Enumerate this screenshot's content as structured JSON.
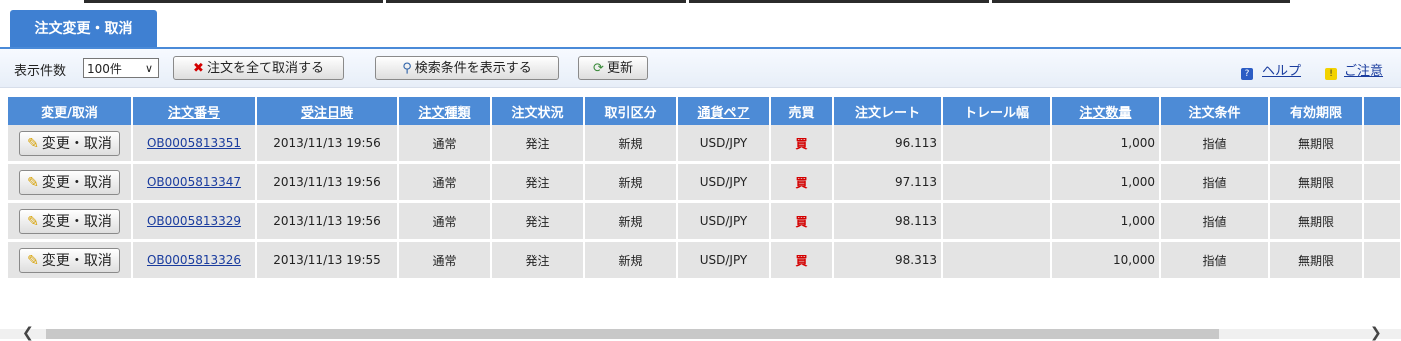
{
  "tab": {
    "label": "注文変更・取消"
  },
  "toolbar": {
    "count_label": "表示件数",
    "count_value": "100件",
    "cancel_all": "注文を全て取消する",
    "show_search": "検索条件を表示する",
    "refresh": "更新",
    "help": "ヘルプ",
    "caution": "ご注意"
  },
  "table": {
    "headers": [
      "変更/取消",
      "注文番号",
      "受注日時",
      "注文種類",
      "注文状況",
      "取引区分",
      "通貨ペア",
      "売買",
      "注文レート",
      "トレール幅",
      "注文数量",
      "注文条件",
      "有効期限"
    ],
    "edit_label": "変更・取消",
    "rows": [
      {
        "order_no": "OB0005813351",
        "date": "2013/11/13 19:56",
        "type": "通常",
        "status": "発注",
        "kind": "新規",
        "pair": "USD/JPY",
        "side": "買",
        "rate": "96.113",
        "trail": "",
        "qty": "1,000",
        "cond": "指値",
        "expiry": "無期限"
      },
      {
        "order_no": "OB0005813347",
        "date": "2013/11/13 19:56",
        "type": "通常",
        "status": "発注",
        "kind": "新規",
        "pair": "USD/JPY",
        "side": "買",
        "rate": "97.113",
        "trail": "",
        "qty": "1,000",
        "cond": "指値",
        "expiry": "無期限"
      },
      {
        "order_no": "OB0005813329",
        "date": "2013/11/13 19:56",
        "type": "通常",
        "status": "発注",
        "kind": "新規",
        "pair": "USD/JPY",
        "side": "買",
        "rate": "98.113",
        "trail": "",
        "qty": "1,000",
        "cond": "指値",
        "expiry": "無期限"
      },
      {
        "order_no": "OB0005813326",
        "date": "2013/11/13 19:55",
        "type": "通常",
        "status": "発注",
        "kind": "新規",
        "pair": "USD/JPY",
        "side": "買",
        "rate": "98.313",
        "trail": "",
        "qty": "10,000",
        "cond": "指値",
        "expiry": "無期限"
      }
    ]
  },
  "colors": {
    "tab": "#3f80d2",
    "header": "#4d8bd6",
    "row": "#e4e4e4",
    "buy": "#d40000",
    "link": "#1a3c9e"
  }
}
